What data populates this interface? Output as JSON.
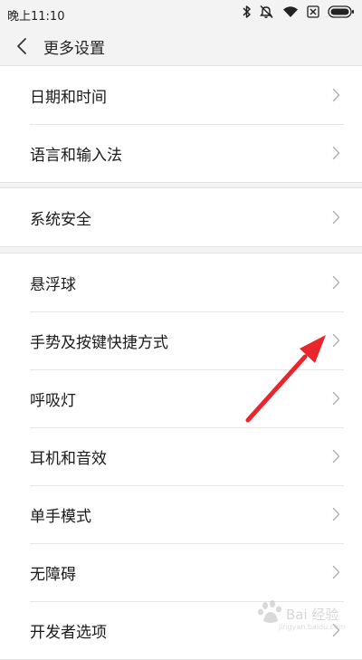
{
  "status_bar": {
    "time": "晚上11:10",
    "icons": [
      "bluetooth-icon",
      "mute-icon",
      "wifi-icon",
      "sim-disabled-icon",
      "battery-icon"
    ]
  },
  "header": {
    "back_icon": "chevron-left-icon",
    "title": "更多设置"
  },
  "groups": [
    {
      "items": [
        {
          "label": "日期和时间"
        },
        {
          "label": "语言和输入法"
        }
      ]
    },
    {
      "items": [
        {
          "label": "系统安全"
        }
      ]
    },
    {
      "items": [
        {
          "label": "悬浮球"
        },
        {
          "label": "手势及按键快捷方式"
        },
        {
          "label": "呼吸灯"
        },
        {
          "label": "耳机和音效"
        },
        {
          "label": "单手模式"
        },
        {
          "label": "无障碍"
        },
        {
          "label": "开发者选项"
        }
      ]
    }
  ],
  "annotation": {
    "color": "#e8262b",
    "target": "手势及按键快捷方式"
  },
  "watermark": {
    "text": "Bai 经验",
    "subtext": "jingyan.baidu.com"
  },
  "colors": {
    "background": "#f3f3f3",
    "panel": "#ffffff",
    "chevron": "#b5b5b5"
  }
}
